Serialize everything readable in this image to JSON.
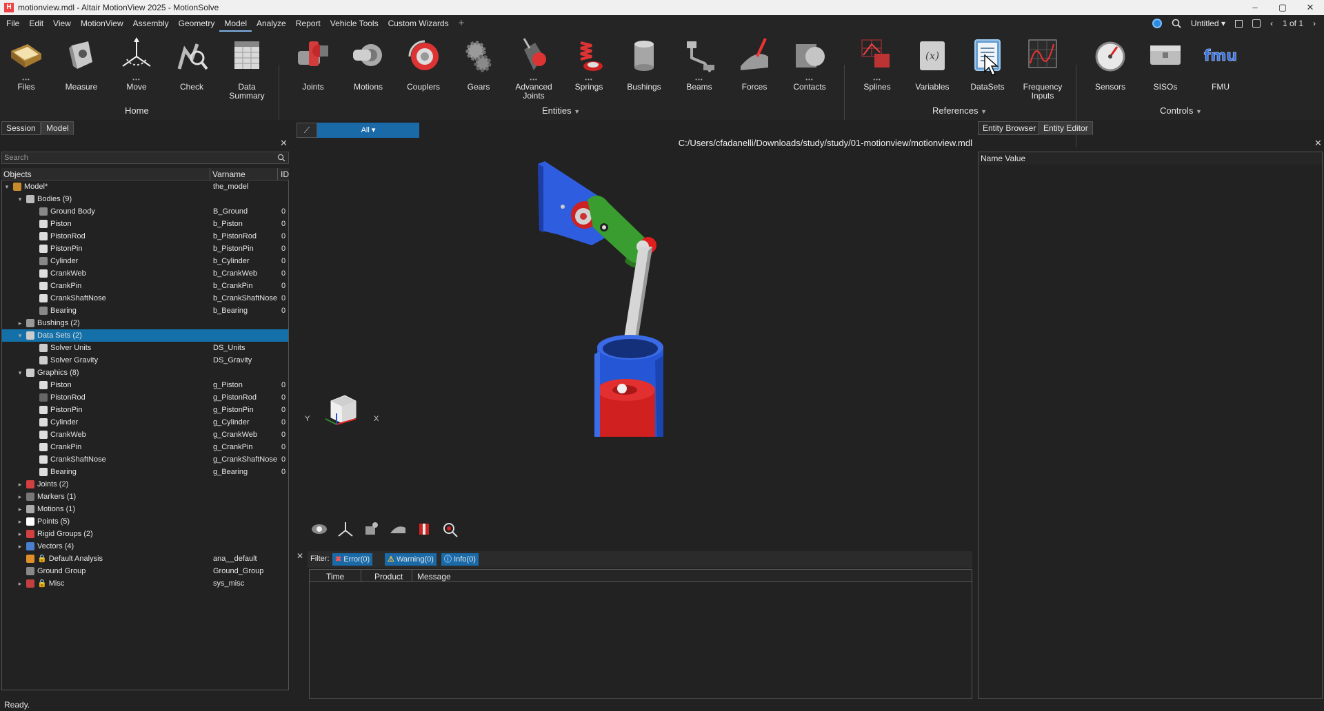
{
  "window": {
    "title": "motionview.mdl - Altair MotionView 2025 - MotionSolve",
    "controls": [
      "–",
      "▢",
      "✕"
    ]
  },
  "menu": {
    "items": [
      "File",
      "Edit",
      "View",
      "MotionView",
      "Assembly",
      "Geometry",
      "Model",
      "Analyze",
      "Report",
      "Vehicle Tools",
      "Custom Wizards"
    ],
    "active": "Model",
    "add": "+",
    "session_name": "Untitled",
    "page": "1 of 1"
  },
  "ribbon": {
    "tools": [
      {
        "id": "files",
        "label": "Files"
      },
      {
        "id": "measure",
        "label": "Measure"
      },
      {
        "id": "move",
        "label": "Move"
      },
      {
        "id": "check",
        "label": "Check"
      },
      {
        "id": "data-summary",
        "label": "Data Summary"
      },
      {
        "id": "joints",
        "label": "Joints"
      },
      {
        "id": "motions",
        "label": "Motions"
      },
      {
        "id": "couplers",
        "label": "Couplers"
      },
      {
        "id": "gears",
        "label": "Gears"
      },
      {
        "id": "advanced-joints",
        "label": "Advanced Joints"
      },
      {
        "id": "springs",
        "label": "Springs"
      },
      {
        "id": "bushings",
        "label": "Bushings"
      },
      {
        "id": "beams",
        "label": "Beams"
      },
      {
        "id": "forces",
        "label": "Forces"
      },
      {
        "id": "contacts",
        "label": "Contacts"
      },
      {
        "id": "splines",
        "label": "Splines"
      },
      {
        "id": "variables",
        "label": "Variables"
      },
      {
        "id": "datasets",
        "label": "DataSets"
      },
      {
        "id": "frequency-inputs",
        "label": "Frequency Inputs"
      },
      {
        "id": "sensors",
        "label": "Sensors"
      },
      {
        "id": "sisos",
        "label": "SISOs"
      },
      {
        "id": "fmu",
        "label": "FMU"
      }
    ],
    "groups": [
      "Home",
      "Entities",
      "References",
      "Controls"
    ],
    "dropdown": "▼"
  },
  "left_panel": {
    "tabs": [
      "Session",
      "Model"
    ],
    "search_placeholder": "Search",
    "columns": [
      "Objects",
      "Varname",
      "ID"
    ],
    "rows": [
      {
        "depth": 0,
        "arrow": "▾",
        "name": "Model*",
        "var": "the_model",
        "id": "",
        "color": "#c98a2e"
      },
      {
        "depth": 1,
        "arrow": "▾",
        "name": "Bodies (9)",
        "var": "",
        "id": "",
        "color": "#bbbbbb"
      },
      {
        "depth": 2,
        "arrow": "",
        "name": "Ground Body",
        "var": "B_Ground",
        "id": "0",
        "color": "#888888"
      },
      {
        "depth": 2,
        "arrow": "",
        "name": "Piston",
        "var": "b_Piston",
        "id": "0",
        "color": "#dddddd"
      },
      {
        "depth": 2,
        "arrow": "",
        "name": "PistonRod",
        "var": "b_PistonRod",
        "id": "0",
        "color": "#dddddd"
      },
      {
        "depth": 2,
        "arrow": "",
        "name": "PistonPin",
        "var": "b_PistonPin",
        "id": "0",
        "color": "#dddddd"
      },
      {
        "depth": 2,
        "arrow": "",
        "name": "Cylinder",
        "var": "b_Cylinder",
        "id": "0",
        "color": "#888888"
      },
      {
        "depth": 2,
        "arrow": "",
        "name": "CrankWeb",
        "var": "b_CrankWeb",
        "id": "0",
        "color": "#dddddd"
      },
      {
        "depth": 2,
        "arrow": "",
        "name": "CrankPin",
        "var": "b_CrankPin",
        "id": "0",
        "color": "#dddddd"
      },
      {
        "depth": 2,
        "arrow": "",
        "name": "CrankShaftNose",
        "var": "b_CrankShaftNose",
        "id": "0",
        "color": "#dddddd"
      },
      {
        "depth": 2,
        "arrow": "",
        "name": "Bearing",
        "var": "b_Bearing",
        "id": "0",
        "color": "#888888"
      },
      {
        "depth": 1,
        "arrow": "▸",
        "name": "Bushings (2)",
        "var": "",
        "id": "",
        "color": "#999999"
      },
      {
        "depth": 1,
        "arrow": "▾",
        "name": "Data Sets (2)",
        "var": "",
        "id": "",
        "color": "#cccccc",
        "selected": true
      },
      {
        "depth": 2,
        "arrow": "",
        "name": "Solver Units",
        "var": "DS_Units",
        "id": "",
        "color": "#cccccc"
      },
      {
        "depth": 2,
        "arrow": "",
        "name": "Solver Gravity",
        "var": "DS_Gravity",
        "id": "",
        "color": "#cccccc"
      },
      {
        "depth": 1,
        "arrow": "▾",
        "name": "Graphics (8)",
        "var": "",
        "id": "",
        "color": "#cccccc"
      },
      {
        "depth": 2,
        "arrow": "",
        "name": "Piston",
        "var": "g_Piston",
        "id": "0",
        "color": "#dddddd"
      },
      {
        "depth": 2,
        "arrow": "",
        "name": "PistonRod",
        "var": "g_PistonRod",
        "id": "0",
        "color": "#666666"
      },
      {
        "depth": 2,
        "arrow": "",
        "name": "PistonPin",
        "var": "g_PistonPin",
        "id": "0",
        "color": "#dddddd"
      },
      {
        "depth": 2,
        "arrow": "",
        "name": "Cylinder",
        "var": "g_Cylinder",
        "id": "0",
        "color": "#dddddd"
      },
      {
        "depth": 2,
        "arrow": "",
        "name": "CrankWeb",
        "var": "g_CrankWeb",
        "id": "0",
        "color": "#dddddd"
      },
      {
        "depth": 2,
        "arrow": "",
        "name": "CrankPin",
        "var": "g_CrankPin",
        "id": "0",
        "color": "#dddddd"
      },
      {
        "depth": 2,
        "arrow": "",
        "name": "CrankShaftNose",
        "var": "g_CrankShaftNose",
        "id": "0",
        "color": "#dddddd"
      },
      {
        "depth": 2,
        "arrow": "",
        "name": "Bearing",
        "var": "g_Bearing",
        "id": "0",
        "color": "#dddddd"
      },
      {
        "depth": 1,
        "arrow": "▸",
        "name": "Joints (2)",
        "var": "",
        "id": "",
        "color": "#d04040"
      },
      {
        "depth": 1,
        "arrow": "▸",
        "name": "Markers (1)",
        "var": "",
        "id": "",
        "color": "#777777"
      },
      {
        "depth": 1,
        "arrow": "▸",
        "name": "Motions (1)",
        "var": "",
        "id": "",
        "color": "#aaaaaa"
      },
      {
        "depth": 1,
        "arrow": "▸",
        "name": "Points (5)",
        "var": "",
        "id": "",
        "color": "#ffffff"
      },
      {
        "depth": 1,
        "arrow": "▸",
        "name": "Rigid Groups (2)",
        "var": "",
        "id": "",
        "color": "#d04040"
      },
      {
        "depth": 1,
        "arrow": "▸",
        "name": "Vectors (4)",
        "var": "",
        "id": "",
        "color": "#4a7fd0"
      },
      {
        "depth": 1,
        "arrow": "",
        "name": "🔒 Default Analysis",
        "var": "ana__default",
        "id": "",
        "color": "#e0902a"
      },
      {
        "depth": 1,
        "arrow": "",
        "name": "Ground Group",
        "var": "Ground_Group",
        "id": "",
        "color": "#888888"
      },
      {
        "depth": 1,
        "arrow": "▸",
        "name": "🔒 Misc",
        "var": "sys_misc",
        "id": "",
        "color": "#c04040"
      }
    ]
  },
  "viewport": {
    "filter": "All",
    "path": "C:/Users/cfadanelli/Downloads/study/study/01-motionview/motionview.mdl",
    "axis_x": "X",
    "axis_y": "Y"
  },
  "messages": {
    "filter_label": "Filter:",
    "error": "Error(0)",
    "warning": "Warning(0)",
    "info": "Info(0)",
    "columns": [
      "Time",
      "Product",
      "Message"
    ]
  },
  "right_panel": {
    "tabs": [
      "Entity Browser",
      "Entity Editor"
    ],
    "columns": "Name  Value"
  },
  "status": "Ready."
}
